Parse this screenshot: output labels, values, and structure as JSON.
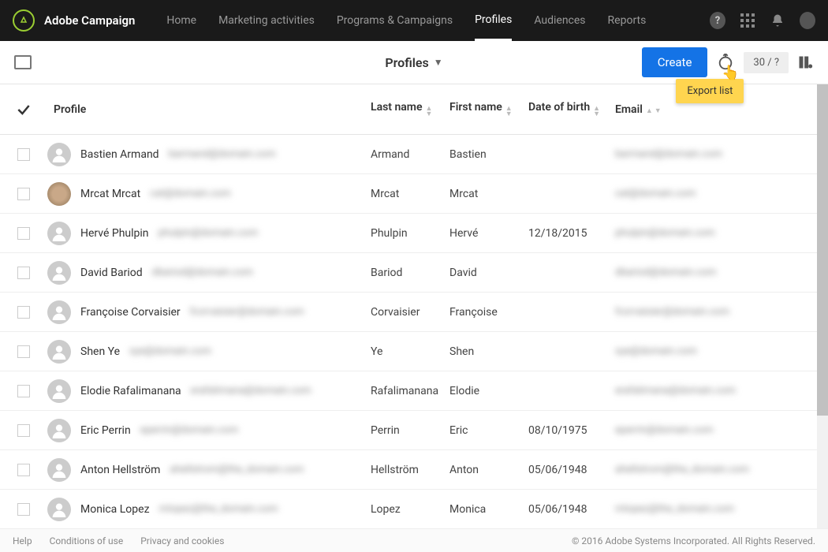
{
  "header": {
    "brand": "Adobe Campaign",
    "nav": [
      "Home",
      "Marketing activities",
      "Programs & Campaigns",
      "Profiles",
      "Audiences",
      "Reports"
    ],
    "active_index": 3
  },
  "subbar": {
    "title": "Profiles",
    "create_label": "Create",
    "export_tooltip": "Export list",
    "count_badge": "30 / ?"
  },
  "columns": {
    "profile": "Profile",
    "last": "Last name",
    "first": "First name",
    "dob": "Date of birth",
    "email": "Email"
  },
  "rows": [
    {
      "name": "Bastien Armand",
      "blur1": "barmand@domain.com",
      "last": "Armand",
      "first": "Bastien",
      "dob": "",
      "email_blur": "barmand@domain.com",
      "avatar": "default"
    },
    {
      "name": "Mrcat Mrcat",
      "blur1": "cat@domain.com",
      "last": "Mrcat",
      "first": "Mrcat",
      "dob": "",
      "email_blur": "cat@domain.com",
      "avatar": "cat"
    },
    {
      "name": "Hervé Phulpin",
      "blur1": "phulpin@domain.com",
      "last": "Phulpin",
      "first": "Hervé",
      "dob": "12/18/2015",
      "email_blur": "phulpin@domain.com",
      "avatar": "default"
    },
    {
      "name": "David Bariod",
      "blur1": "dbariod@domain.com",
      "last": "Bariod",
      "first": "David",
      "dob": "",
      "email_blur": "dbariod@domain.com",
      "avatar": "default"
    },
    {
      "name": "Françoise Corvaisier",
      "blur1": "fcorvaisier@domain.com",
      "last": "Corvaisier",
      "first": "Françoise",
      "dob": "",
      "email_blur": "fcorvaisier@domain.com",
      "avatar": "default"
    },
    {
      "name": "Shen Ye",
      "blur1": "sye@domain.com",
      "last": "Ye",
      "first": "Shen",
      "dob": "",
      "email_blur": "sye@domain.com",
      "avatar": "default"
    },
    {
      "name": "Elodie Rafalimanana",
      "blur1": "erafalimana@domain.com",
      "last": "Rafalimanana",
      "first": "Elodie",
      "dob": "",
      "email_blur": "erafalimana@domain.com",
      "avatar": "default"
    },
    {
      "name": "Eric Perrin",
      "blur1": "eperrin@domain.com",
      "last": "Perrin",
      "first": "Eric",
      "dob": "08/10/1975",
      "email_blur": "eperrin@domain.com",
      "avatar": "default"
    },
    {
      "name": "Anton Hellström",
      "blur1": "ahellstrom@the_domain.com",
      "last": "Hellström",
      "first": "Anton",
      "dob": "05/06/1948",
      "email_blur": "ahellstrom@the_domain.com",
      "avatar": "default"
    },
    {
      "name": "Monica Lopez",
      "blur1": "mlopez@the_domain.com",
      "last": "Lopez",
      "first": "Monica",
      "dob": "05/06/1948",
      "email_blur": "mlopez@the_domain.com",
      "avatar": "default"
    }
  ],
  "footer": {
    "links": [
      "Help",
      "Conditions of use",
      "Privacy and cookies"
    ],
    "copyright": "© 2016 Adobe Systems Incorporated. All Rights Reserved."
  }
}
